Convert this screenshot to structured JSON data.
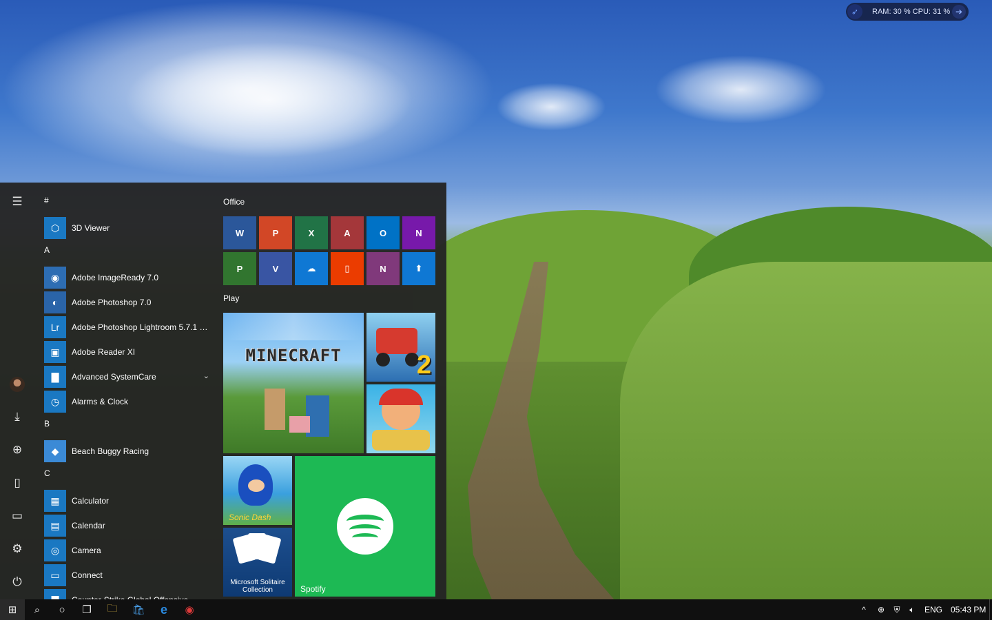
{
  "widget": {
    "text": "RAM: 30 %  CPU: 31 %",
    "rocket": "rocket-icon",
    "arrow": "arrow-right-icon"
  },
  "rail": [
    {
      "name": "hamburger-menu-icon",
      "glyph": "☰"
    },
    {
      "name": "user-avatar",
      "glyph": ""
    },
    {
      "name": "downloads-icon",
      "glyph": "⤓"
    },
    {
      "name": "network-globe-icon",
      "glyph": "🌐"
    },
    {
      "name": "documents-icon",
      "glyph": "🗎"
    },
    {
      "name": "file-explorer-icon",
      "glyph": "🗀"
    },
    {
      "name": "settings-gear-icon",
      "glyph": "⚙"
    },
    {
      "name": "power-icon",
      "glyph": "⏻"
    }
  ],
  "apps": [
    {
      "type": "letter",
      "label": "#"
    },
    {
      "type": "app",
      "label": "3D Viewer",
      "icon": "cube-icon",
      "glyph": "⬡",
      "bg": "#1a78c2"
    },
    {
      "type": "letter",
      "label": "A"
    },
    {
      "type": "app",
      "label": "Adobe ImageReady 7.0",
      "icon": "imageready-icon",
      "glyph": "◉",
      "bg": "#2d6db3"
    },
    {
      "type": "app",
      "label": "Adobe Photoshop 7.0",
      "icon": "photoshop-icon",
      "glyph": "◐",
      "bg": "#2a64a8"
    },
    {
      "type": "app",
      "label": "Adobe Photoshop Lightroom 5.7.1 6...",
      "icon": "lightroom-icon",
      "glyph": "Lr",
      "bg": "#1a78c2"
    },
    {
      "type": "app",
      "label": "Adobe Reader XI",
      "icon": "reader-icon",
      "glyph": "▣",
      "bg": "#1a78c2"
    },
    {
      "type": "app",
      "label": "Advanced SystemCare",
      "icon": "folder-icon",
      "glyph": "▇",
      "bg": "#1a78c2",
      "chevron": "⌄"
    },
    {
      "type": "app",
      "label": "Alarms & Clock",
      "icon": "clock-icon",
      "glyph": "◷",
      "bg": "#1a78c2"
    },
    {
      "type": "letter",
      "label": "B"
    },
    {
      "type": "app",
      "label": "Beach Buggy Racing",
      "icon": "beach-buggy-icon",
      "glyph": "◆",
      "bg": "#3b8ad6"
    },
    {
      "type": "letter",
      "label": "C"
    },
    {
      "type": "app",
      "label": "Calculator",
      "icon": "calculator-icon",
      "glyph": "▦",
      "bg": "#1a78c2"
    },
    {
      "type": "app",
      "label": "Calendar",
      "icon": "calendar-icon",
      "glyph": "▤",
      "bg": "#1a78c2"
    },
    {
      "type": "app",
      "label": "Camera",
      "icon": "camera-icon",
      "glyph": "◎",
      "bg": "#1a78c2"
    },
    {
      "type": "app",
      "label": "Connect",
      "icon": "connect-icon",
      "glyph": "▭",
      "bg": "#1a78c2"
    },
    {
      "type": "app",
      "label": "Counter-Strike Global Offensive",
      "icon": "folder-icon",
      "glyph": "▇",
      "bg": "#1a78c2",
      "chevron": "⌄"
    }
  ],
  "groups": {
    "office": "Office",
    "play": "Play"
  },
  "office_tiles": [
    {
      "name": "word-tile",
      "letter": "W",
      "bg": "#2b579a"
    },
    {
      "name": "powerpoint-tile",
      "letter": "P",
      "bg": "#d24726"
    },
    {
      "name": "excel-tile",
      "letter": "X",
      "bg": "#217346"
    },
    {
      "name": "access-tile",
      "letter": "A",
      "bg": "#a4373a"
    },
    {
      "name": "outlook-tile",
      "letter": "O",
      "bg": "#0072c6"
    },
    {
      "name": "onenote-tile",
      "letter": "N",
      "bg": "#7719aa"
    },
    {
      "name": "project-tile",
      "letter": "P",
      "bg": "#31752f"
    },
    {
      "name": "visio-tile",
      "letter": "V",
      "bg": "#3955a3"
    },
    {
      "name": "onedrive-tile",
      "letter": "☁",
      "bg": "#0f78d4"
    },
    {
      "name": "office-tile",
      "letter": "▯",
      "bg": "#eb3c00"
    },
    {
      "name": "onenote2-tile",
      "letter": "N",
      "bg": "#80397b"
    },
    {
      "name": "update-tile",
      "letter": "⬆",
      "bg": "#0f78d4"
    }
  ],
  "play_tiles": {
    "minecraft": "MINECRAFT",
    "hill_climb_num": "2",
    "sonic": "Sonic Dash",
    "solitaire": "Microsoft Solitaire Collection",
    "spotify": "Spotify"
  },
  "taskbar": {
    "icons": [
      {
        "name": "start-windows-icon",
        "glyph": "⊞"
      },
      {
        "name": "search-icon",
        "glyph": "⌕"
      },
      {
        "name": "cortana-icon",
        "glyph": "○"
      },
      {
        "name": "task-view-icon",
        "glyph": "❐"
      },
      {
        "name": "file-explorer-taskbar-icon",
        "glyph": "🗀"
      },
      {
        "name": "store-icon",
        "glyph": "🛍"
      },
      {
        "name": "edge-icon",
        "glyph": "e"
      },
      {
        "name": "app-red-icon",
        "glyph": "◉"
      }
    ],
    "tray": {
      "chevron": "^",
      "lang": "ENG",
      "time": "05:43 PM"
    }
  }
}
